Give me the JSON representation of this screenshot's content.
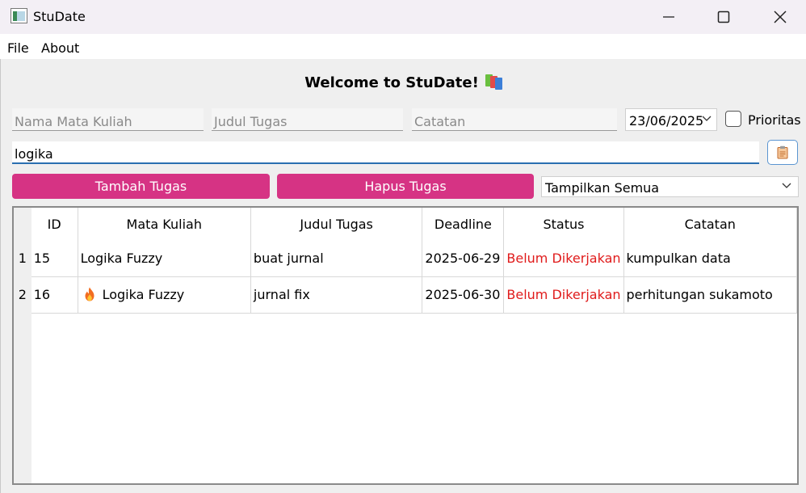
{
  "window": {
    "title": "StuDate",
    "icon": "app-window-icon",
    "controls": [
      "minimize-icon",
      "maximize-icon",
      "close-icon"
    ]
  },
  "menu": {
    "file": "File",
    "about": "About"
  },
  "welcome": "Welcome to StuDate!",
  "form": {
    "nama_placeholder": "Nama Mata Kuliah",
    "judul_placeholder": "Judul Tugas",
    "catatan_placeholder": "Catatan",
    "date_value": "23/06/2025",
    "prioritas_label": "Prioritas",
    "prioritas_checked": false
  },
  "search": {
    "value": "logika",
    "button_icon": "clipboard-icon"
  },
  "buttons": {
    "tambah": "Tambah Tugas",
    "hapus": "Hapus Tugas",
    "pink_color": "#d63384"
  },
  "filter": {
    "selected": "Tampilkan Semua"
  },
  "table": {
    "columns": [
      "ID",
      "Mata Kuliah",
      "Judul Tugas",
      "Deadline",
      "Status",
      "Catatan"
    ],
    "status_color": "#e01b1b",
    "rows": [
      {
        "num": "1",
        "id": "15",
        "mata_kuliah": "Logika Fuzzy",
        "priority_icon": "",
        "judul": "buat jurnal",
        "deadline": "2025-06-29",
        "status": "Belum Dikerjakan",
        "catatan": "kumpulkan data"
      },
      {
        "num": "2",
        "id": "16",
        "mata_kuliah": "Logika Fuzzy",
        "priority_icon": "fire-icon",
        "judul": "jurnal fix",
        "deadline": "2025-06-30",
        "status": "Belum Dikerjakan",
        "catatan": "perhitungan sukamoto"
      }
    ]
  }
}
